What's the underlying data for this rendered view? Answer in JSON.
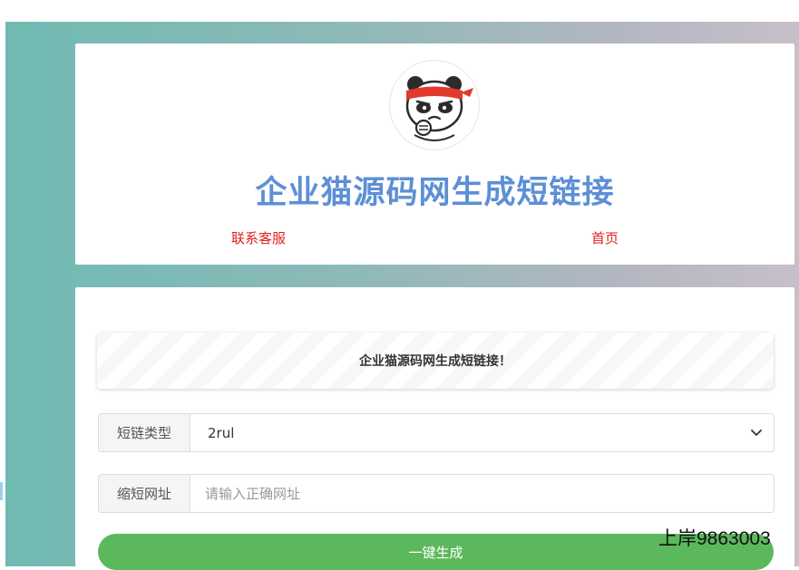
{
  "header": {
    "title": "企业猫源码网生成短链接",
    "nav": {
      "contact": "联系客服",
      "home": "首页"
    }
  },
  "notice": {
    "text": "企业猫源码网生成短链接！"
  },
  "form": {
    "type_label": "短链类型",
    "type_selected": "2rul",
    "url_label": "缩短网址",
    "url_placeholder": "请输入正确网址",
    "url_value": "",
    "submit_label": "一键生成"
  },
  "overlay": {
    "watermark": "上岸9863003"
  },
  "icons": {
    "avatar": "panda-headband-avatar-icon",
    "select_arrow": "chevron-down-icon"
  },
  "colors": {
    "title": "#5d8fd6",
    "nav_link": "#e02020",
    "submit": "#5cb85c"
  }
}
